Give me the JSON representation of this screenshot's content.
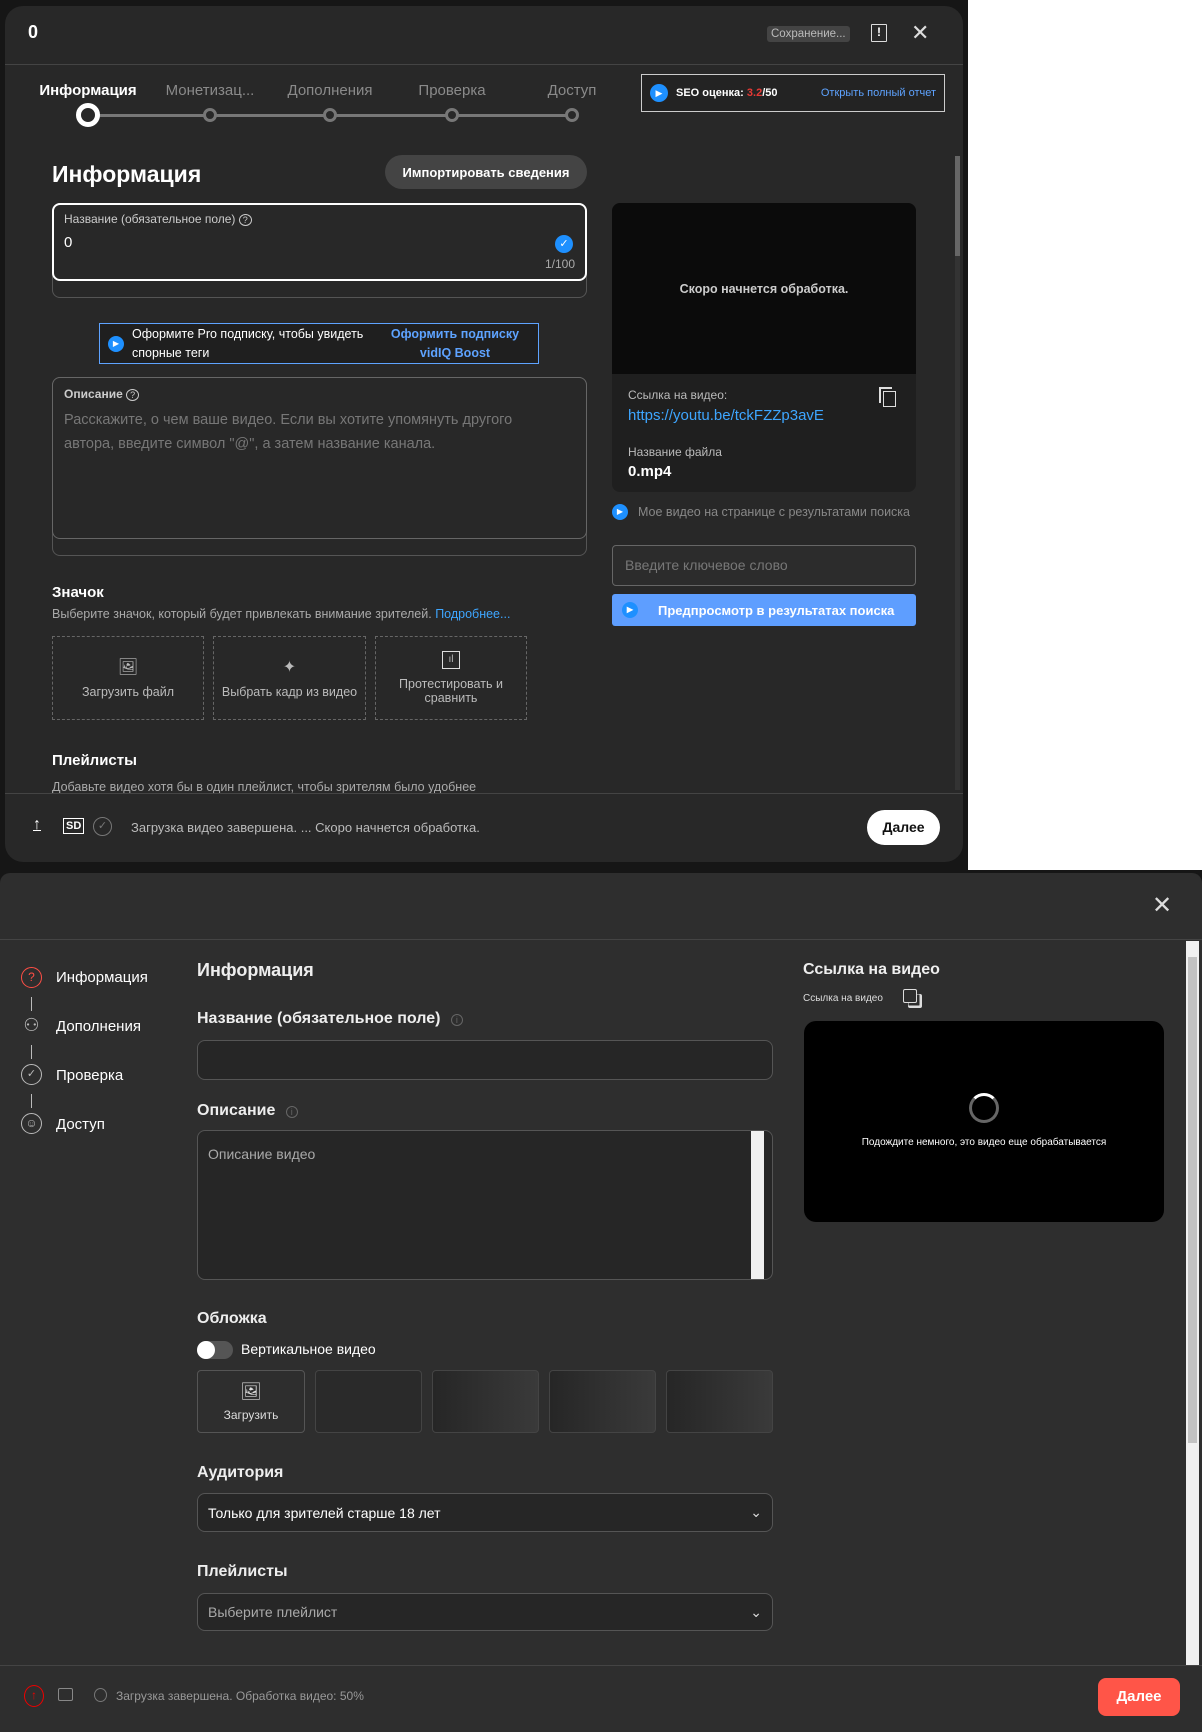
{
  "top": {
    "title": "0",
    "saving": "Сохранение...",
    "steps": [
      "Информация",
      "Монетизац...",
      "Дополнения",
      "Проверка",
      "Доступ"
    ],
    "seo": {
      "label": "SEO оценка:",
      "score": "3.2",
      "max": "/50",
      "link": "Открыть полный отчет",
      "score_color": "#e53935"
    },
    "heading": "Информация",
    "import_button": "Импортировать сведения",
    "title_field": {
      "label": "Название (обязательное поле)",
      "value": "0",
      "counter": "1/100"
    },
    "pro": {
      "text": "Оформите Pro подписку, чтобы увидеть спорные теги",
      "link": "Оформить подписку vidIQ Boost"
    },
    "description": {
      "label": "Описание",
      "placeholder": "Расскажите, о чем ваше видео. Если вы хотите упомянуть другого автора, введите символ \"@\", а затем название канала."
    },
    "thumbnail": {
      "heading": "Значок",
      "desc": "Выберите значок, который будет привлекать внимание зрителей.",
      "more": "Подробнее...",
      "options": [
        "Загрузить файл",
        "Выбрать кадр из видео",
        "Протестировать и сравнить"
      ]
    },
    "playlists": {
      "heading": "Плейлисты",
      "desc": "Добавьте видео хотя бы в один плейлист, чтобы зрителям было удобнее"
    },
    "video": {
      "status": "Скоро начнется обработка.",
      "link_label": "Ссылка на видео:",
      "link": "https://youtu.be/tckFZZp3avE",
      "file_label": "Название файла",
      "file": "0.mp4"
    },
    "search_preview": {
      "label": "Мое видео на странице с результатами поиска",
      "placeholder": "Введите ключевое слово",
      "button": "Предпросмотр в результатах поиска"
    },
    "footer": {
      "sd": "SD",
      "status": "Загрузка видео завершена. ... Скоро начнется обработка.",
      "next": "Далее"
    }
  },
  "bottom": {
    "steps": [
      "Информация",
      "Дополнения",
      "Проверка",
      "Доступ"
    ],
    "heading": "Информация",
    "title_label": "Название (обязательное поле)",
    "desc_label": "Описание",
    "desc_placeholder": "Описание видео",
    "cover": {
      "heading": "Обложка",
      "toggle": "Вертикальное видео",
      "toggle_on": false,
      "upload": "Загрузить"
    },
    "audience": {
      "heading": "Аудитория",
      "value": "Только для зрителей старше 18 лет"
    },
    "playlists": {
      "heading": "Плейлисты",
      "placeholder": "Выберите плейлист"
    },
    "video": {
      "heading": "Ссылка на видео",
      "link_label": "Ссылка на видео",
      "processing": "Подождите немного, это видео еще обрабатывается"
    },
    "footer": {
      "status": "Загрузка завершена. Обработка видео: 50%",
      "next": "Далее",
      "accent": "#ff5548"
    }
  }
}
